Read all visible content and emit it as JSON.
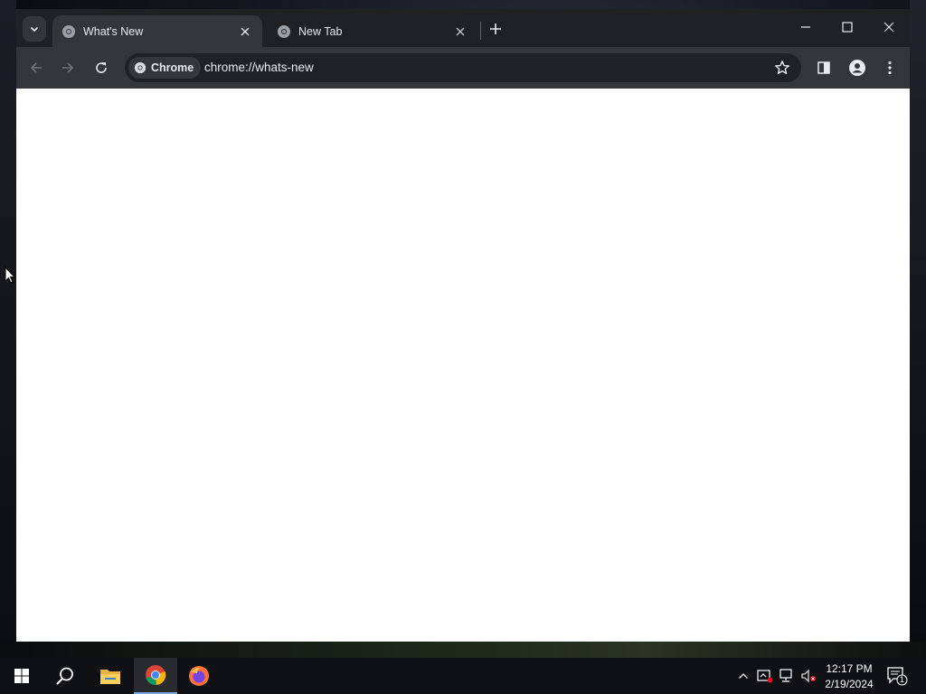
{
  "browser": {
    "tabs": [
      {
        "title": "What's New",
        "active": true
      },
      {
        "title": "New Tab",
        "active": false
      }
    ],
    "omnibox": {
      "chip_label": "Chrome",
      "url": "chrome://whats-new"
    },
    "icons": {
      "tab_search": "chevron-down-icon",
      "new_tab": "plus-icon",
      "back": "arrow-left-icon",
      "forward": "arrow-right-icon",
      "reload": "reload-icon",
      "bookmark": "star-icon",
      "side_panel": "side-panel-icon",
      "profile": "profile-icon",
      "menu": "kebab-menu-icon"
    },
    "colors": {
      "frame": "#202124",
      "toolbar": "#35363a",
      "text": "#e8eaed",
      "content": "#ffffff"
    }
  },
  "taskbar": {
    "apps": [
      "start-icon",
      "search-icon",
      "file-explorer-icon",
      "chrome-icon",
      "firefox-icon"
    ],
    "clock": {
      "time": "12:17 PM",
      "date": "2/19/2024"
    },
    "notification_count": "1"
  }
}
